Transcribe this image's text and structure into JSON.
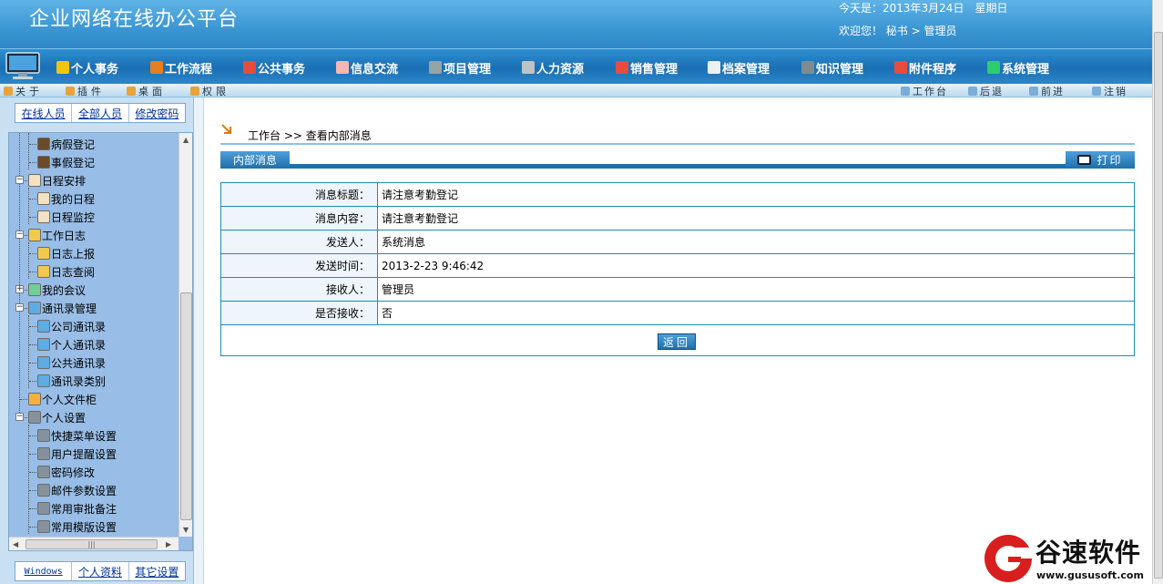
{
  "header": {
    "title": "企业网络在线办公平台",
    "date_text": "今天是：2013年3月24日　星期日",
    "welcome_text": "欢迎您！ 秘书 > 管理员"
  },
  "mainnav": [
    {
      "label": "个人事务",
      "icon": "person-icon",
      "color": "#f1c40f"
    },
    {
      "label": "工作流程",
      "icon": "workflow-icon",
      "color": "#e67e22"
    },
    {
      "label": "公共事务",
      "icon": "people-icon",
      "color": "#e74c3c"
    },
    {
      "label": "信息交流",
      "icon": "chat-icon",
      "color": "#f5b7b1"
    },
    {
      "label": "项目管理",
      "icon": "project-icon",
      "color": "#95a5a6"
    },
    {
      "label": "人力资源",
      "icon": "hr-icon",
      "color": "#bdc3c7"
    },
    {
      "label": "销售管理",
      "icon": "gift-icon",
      "color": "#e74c3c"
    },
    {
      "label": "档案管理",
      "icon": "archive-icon",
      "color": "#ecf0f1"
    },
    {
      "label": "知识管理",
      "icon": "book-icon",
      "color": "#7f8c8d"
    },
    {
      "label": "附件程序",
      "icon": "attachment-icon",
      "color": "#e74c3c"
    },
    {
      "label": "系统管理",
      "icon": "system-icon",
      "color": "#2ecc71"
    }
  ],
  "subbar": {
    "left": [
      {
        "label": "关于",
        "icon": "about-icon"
      },
      {
        "label": "插件",
        "icon": "plugin-icon"
      },
      {
        "label": "桌面",
        "icon": "desktop-icon"
      },
      {
        "label": "权限",
        "icon": "permission-icon"
      }
    ],
    "right": [
      {
        "label": "工作台",
        "icon": "home-icon"
      },
      {
        "label": "后退",
        "icon": "back-icon"
      },
      {
        "label": "前进",
        "icon": "forward-icon"
      },
      {
        "label": "注销",
        "icon": "logout-icon"
      }
    ]
  },
  "sidebar": {
    "top_tabs": [
      "在线人员",
      "全部人员",
      "修改密码"
    ],
    "bottom_tabs": [
      "Windows",
      "个人资料",
      "其它设置"
    ],
    "tree": [
      {
        "label": "病假登记",
        "level": 2,
        "icon": "leave-icon"
      },
      {
        "label": "事假登记",
        "level": 2,
        "icon": "leave-icon"
      },
      {
        "label": "日程安排",
        "level": 1,
        "icon": "calendar-icon",
        "expander": "-"
      },
      {
        "label": "我的日程",
        "level": 2,
        "icon": "calendar-icon"
      },
      {
        "label": "日程监控",
        "level": 2,
        "icon": "calendar-icon"
      },
      {
        "label": "工作日志",
        "level": 1,
        "icon": "pencil-icon",
        "expander": "-"
      },
      {
        "label": "日志上报",
        "level": 2,
        "icon": "pencil-icon"
      },
      {
        "label": "日志查阅",
        "level": 2,
        "icon": "pencil-icon"
      },
      {
        "label": "我的会议",
        "level": 1,
        "icon": "meeting-icon",
        "expander": "+"
      },
      {
        "label": "通讯录管理",
        "level": 1,
        "icon": "contacts-icon",
        "expander": "-"
      },
      {
        "label": "公司通讯录",
        "level": 2,
        "icon": "contacts-icon"
      },
      {
        "label": "个人通讯录",
        "level": 2,
        "icon": "contacts-icon"
      },
      {
        "label": "公共通讯录",
        "level": 2,
        "icon": "contacts-icon"
      },
      {
        "label": "通讯录类别",
        "level": 2,
        "icon": "contacts-icon"
      },
      {
        "label": "个人文件柜",
        "level": 1,
        "icon": "folder-icon"
      },
      {
        "label": "个人设置",
        "level": 1,
        "icon": "settings-icon",
        "expander": "-"
      },
      {
        "label": "快捷菜单设置",
        "level": 2,
        "icon": "settings-icon"
      },
      {
        "label": "用户提醒设置",
        "level": 2,
        "icon": "settings-icon"
      },
      {
        "label": "密码修改",
        "level": 2,
        "icon": "settings-icon"
      },
      {
        "label": "邮件参数设置",
        "level": 2,
        "icon": "settings-icon"
      },
      {
        "label": "常用审批备注",
        "level": 2,
        "icon": "settings-icon"
      },
      {
        "label": "常用模版设置",
        "level": 2,
        "icon": "settings-icon"
      }
    ]
  },
  "content": {
    "breadcrumb": "工作台 >>  查看内部消息",
    "tab_label": "内部消息",
    "print_label": "打印",
    "rows": [
      {
        "label": "消息标题：",
        "value": "请注意考勤登记"
      },
      {
        "label": "消息内容：",
        "value": "请注意考勤登记"
      },
      {
        "label": "发送人：",
        "value": "系统消息"
      },
      {
        "label": "发送时间：",
        "value": "2013-2-23 9:46:42"
      },
      {
        "label": "接收人：",
        "value": "管理员"
      },
      {
        "label": "是否接收：",
        "value": "否"
      }
    ],
    "back_label": "返回"
  },
  "watermark": {
    "name": "谷速软件",
    "url": "www.gususoft.com"
  },
  "colors": {
    "header": "#3b96d3",
    "nav": "#1a6fb4",
    "table_border": "#1a8fb6",
    "sidebar_tree": "#98bde6"
  }
}
